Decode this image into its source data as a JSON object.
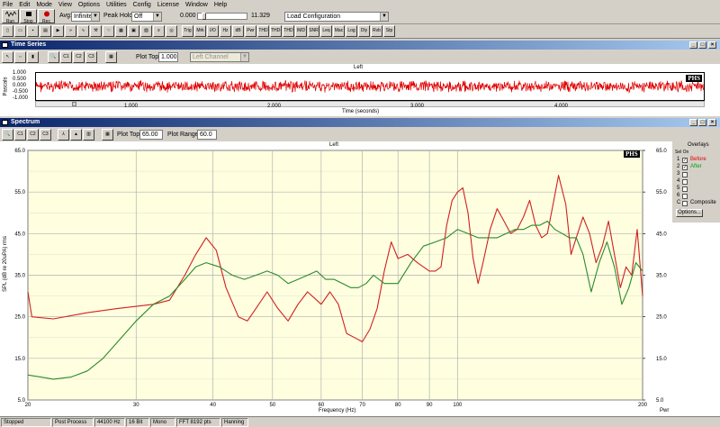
{
  "menu": [
    "File",
    "Edit",
    "Mode",
    "View",
    "Options",
    "Utilities",
    "Config",
    "License",
    "Window",
    "Help"
  ],
  "toolbar": {
    "run_label": "Run",
    "stop_label": "Stop",
    "rec_label": "Rec",
    "avg_label": "Avg:",
    "avg_value": "Infinite",
    "peak_hold_label": "Peak Hold:",
    "peak_hold_value": "Off",
    "slider_min": "0.000",
    "slider_max": "11.329",
    "config_value": "Load Configuration",
    "row2_buttons": [
      "Trig",
      "Mrk",
      "I/O",
      "Hz",
      "dB",
      "Pwr",
      "THD",
      "THD+N",
      "THD Freq",
      "IMD",
      "SNR",
      "Leq",
      "Mac",
      "Log",
      "Dly",
      "Rvb",
      "Stp"
    ]
  },
  "time_series": {
    "title": "Time Series",
    "plot_top_label": "Plot Top:",
    "plot_top_value": "1.000",
    "channel_value": "Left Channel",
    "plot_title": "Left",
    "ylabel": "Pascals",
    "yticks": [
      "1.000",
      "0.500",
      "0.000",
      "-0.500",
      "-1.000"
    ],
    "xticks": [
      "1.000",
      "2.000",
      "3.000",
      "4.000"
    ],
    "xlabel": "Time (seconds)",
    "logo": "PHS"
  },
  "spectrum": {
    "title": "Spectrum",
    "plot_top_label": "Plot Top:",
    "plot_top_value": "65.00",
    "plot_range_label": "Plot Range:",
    "plot_range_value": "60.0",
    "logo": "PHS",
    "overlays_title": "Overlays",
    "overlays_header": "Sel On",
    "overlay_rows": [
      {
        "num": "1",
        "label": "Before",
        "color": "#e00000",
        "checked": true
      },
      {
        "num": "2",
        "label": "After",
        "color": "#00a000",
        "checked": true
      },
      {
        "num": "3",
        "label": "",
        "color": "#000000",
        "checked": false
      },
      {
        "num": "4",
        "label": "",
        "color": "#000000",
        "checked": false
      },
      {
        "num": "5",
        "label": "",
        "color": "#000000",
        "checked": false
      },
      {
        "num": "6",
        "label": "",
        "color": "#000000",
        "checked": false
      },
      {
        "num": "C",
        "label": "Composite",
        "color": "#000000",
        "checked": false
      }
    ],
    "options_label": "Options..."
  },
  "status": [
    "Stopped",
    "Post Process",
    "44100 Hz",
    "16 Bit",
    "Mono",
    "FFT 8192 pts",
    "Hanning"
  ],
  "chart_data": {
    "type": "line",
    "title": "Left",
    "xlabel": "Frequency (Hz)",
    "ylabel": "SPL (dB re 20uPA) rms",
    "y2label": "Pwr",
    "x_scale": "log",
    "xlim": [
      20,
      200
    ],
    "ylim": [
      5,
      65
    ],
    "xticks": [
      "20",
      "30",
      "40",
      "50",
      "60",
      "70",
      "80",
      "90",
      "100",
      "200"
    ],
    "yticks": [
      "65.0",
      "55.0",
      "45.0",
      "35.0",
      "25.0",
      "15.0",
      "5.0"
    ],
    "y2ticks": [
      "65.0",
      "55.0",
      "45.0",
      "35.0",
      "25.0",
      "15.0",
      "5.0"
    ],
    "grid": true,
    "series": [
      {
        "name": "Before",
        "color": "#d02020",
        "x": [
          20,
          20.3,
          22,
          25,
          28,
          30,
          32,
          34,
          36,
          37.5,
          39,
          40.5,
          42,
          44,
          45.5,
          47,
          49,
          51,
          53,
          55,
          57,
          59,
          60,
          62,
          64,
          66,
          68,
          70,
          72,
          74,
          76,
          78,
          80,
          83,
          86,
          88,
          90,
          92,
          94,
          96,
          98,
          100,
          102,
          104,
          106,
          108,
          110,
          113,
          116,
          119,
          122,
          125,
          128,
          131,
          134,
          137,
          140,
          143,
          146,
          150,
          153,
          156,
          160,
          164,
          168,
          172,
          176,
          180,
          184,
          188,
          192,
          196,
          200
        ],
        "y": [
          31,
          25,
          24.5,
          26,
          27,
          27.5,
          28,
          29,
          35,
          40,
          44,
          41,
          32,
          25,
          24,
          27,
          31,
          27,
          24,
          28,
          31,
          29,
          28,
          31,
          28,
          21,
          20,
          19,
          22,
          27,
          36,
          43,
          39,
          40,
          38,
          37,
          36,
          36,
          37,
          47,
          53,
          55,
          56,
          50,
          39,
          33,
          38,
          46,
          51,
          48,
          45,
          46,
          49,
          53,
          47,
          44,
          45,
          52,
          59,
          52,
          40,
          44,
          49,
          45,
          38,
          42,
          48,
          40,
          32,
          37,
          35,
          46,
          30
        ]
      },
      {
        "name": "After",
        "color": "#2a8a2a",
        "x": [
          20,
          21,
          22,
          23.5,
          25,
          26.5,
          28,
          30,
          32,
          34,
          36,
          37.5,
          39,
          41,
          43,
          45,
          47,
          49,
          51,
          53,
          55,
          57,
          59,
          61,
          63,
          65,
          67,
          69,
          71,
          73,
          76,
          80,
          84,
          88,
          92,
          96,
          100,
          104,
          108,
          112,
          116,
          120,
          124,
          128,
          132,
          136,
          140,
          144,
          148,
          152,
          156,
          160,
          165,
          170,
          175,
          180,
          185,
          190,
          195,
          200
        ],
        "y": [
          11,
          10.5,
          10,
          10.5,
          12,
          15,
          19,
          24,
          28,
          30,
          34,
          37,
          38,
          37,
          35,
          34,
          35,
          36,
          35,
          33,
          34,
          35,
          36,
          34,
          34,
          33,
          32,
          32,
          33,
          35,
          33,
          33,
          38,
          42,
          43,
          44,
          46,
          45,
          44,
          44,
          44,
          45,
          46,
          46,
          47,
          47,
          48,
          46,
          45,
          44,
          44,
          40,
          31,
          38,
          43,
          37,
          28,
          32,
          38,
          36
        ]
      }
    ]
  }
}
